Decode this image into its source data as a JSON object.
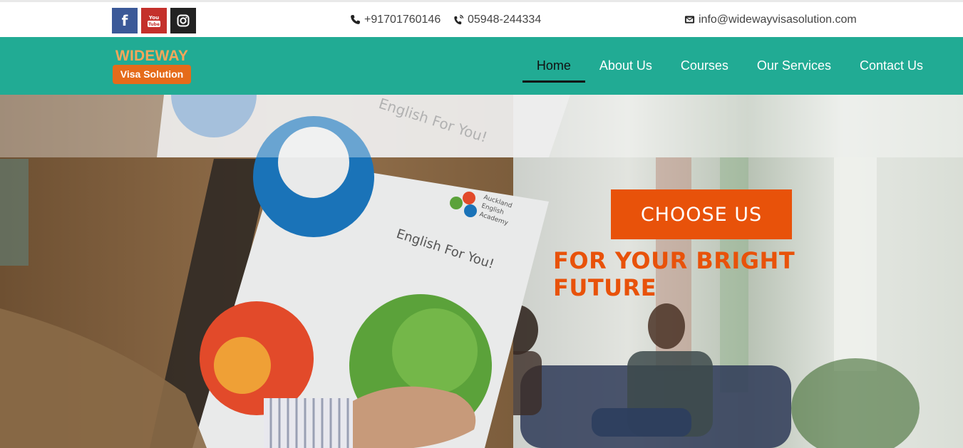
{
  "topbar": {
    "social": [
      {
        "name": "facebook",
        "icon": "facebook-icon",
        "color": "#3b5998"
      },
      {
        "name": "youtube",
        "icon": "youtube-icon",
        "color": "#c4302b"
      },
      {
        "name": "instagram",
        "icon": "instagram-icon",
        "color": "#222222"
      }
    ],
    "phone1": "+91701760146",
    "phone2": "05948-244334",
    "email": "info@widewayvisasolution.com"
  },
  "brand": {
    "name": "WIDEWAY",
    "tagline": "Visa Solution",
    "accent": "#e56b1a",
    "primary": "#21ab94"
  },
  "nav": {
    "items": [
      {
        "label": "Home",
        "active": true
      },
      {
        "label": "About Us",
        "active": false
      },
      {
        "label": "Courses",
        "active": false
      },
      {
        "label": "Our Services",
        "active": false
      },
      {
        "label": "Contact Us",
        "active": false
      }
    ]
  },
  "hero": {
    "button_label": "CHOOSE US",
    "headline": "FOR YOUR BRIGHT FUTURE",
    "accent": "#e8520a",
    "brochure_title": "English For You!",
    "brochure_brand": [
      "Auckland",
      "English",
      "Academy"
    ]
  }
}
